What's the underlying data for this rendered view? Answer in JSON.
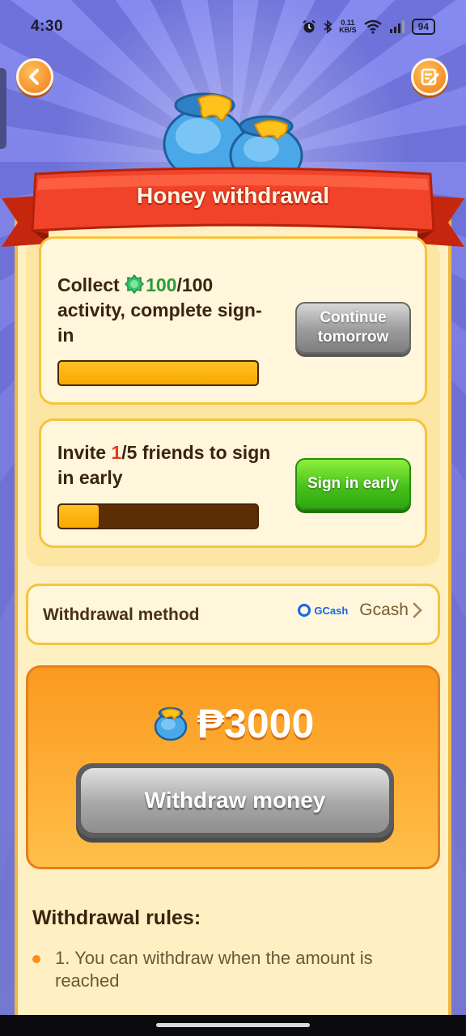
{
  "status_bar": {
    "time": "4:30",
    "net_speed_value": "0.11",
    "net_speed_unit": "KB/S",
    "battery": "94"
  },
  "header": {
    "title": "Honey withdrawal"
  },
  "tasks": [
    {
      "text_prefix": "Collect ",
      "highlight": "100",
      "text_suffix": "/100 activity, complete sign-in",
      "progress": 1.0,
      "button_label": "Continue tomorrow",
      "button_state": "disabled"
    },
    {
      "text_prefix": "Invite ",
      "highlight": "1",
      "text_suffix": "/5 friends to sign in early",
      "progress": 0.2,
      "button_label": "Sign in early",
      "button_state": "active"
    }
  ],
  "withdrawal_method": {
    "label": "Withdrawal method",
    "logo_text": "GCash",
    "value": "Gcash"
  },
  "amount": {
    "value": "₱3000",
    "button_label": "Withdraw money"
  },
  "rules": {
    "title": "Withdrawal rules:",
    "items": [
      "1. You can withdraw when the amount is reached"
    ]
  },
  "colors": {
    "accent_orange": "#fb9a1f",
    "ribbon_red": "#e8321a",
    "panel_cream": "#fff0c4",
    "progress_fill": "#f8a800",
    "progress_track": "#5b2e06",
    "green_button": "#48c21c",
    "gcash_blue": "#1664e8"
  },
  "icons": {
    "back": "chevron-left-icon",
    "edit": "edit-note-icon",
    "gem": "green-gem-icon",
    "honey_pot": "honey-pot-icon",
    "chevron": "chevron-right-icon"
  }
}
